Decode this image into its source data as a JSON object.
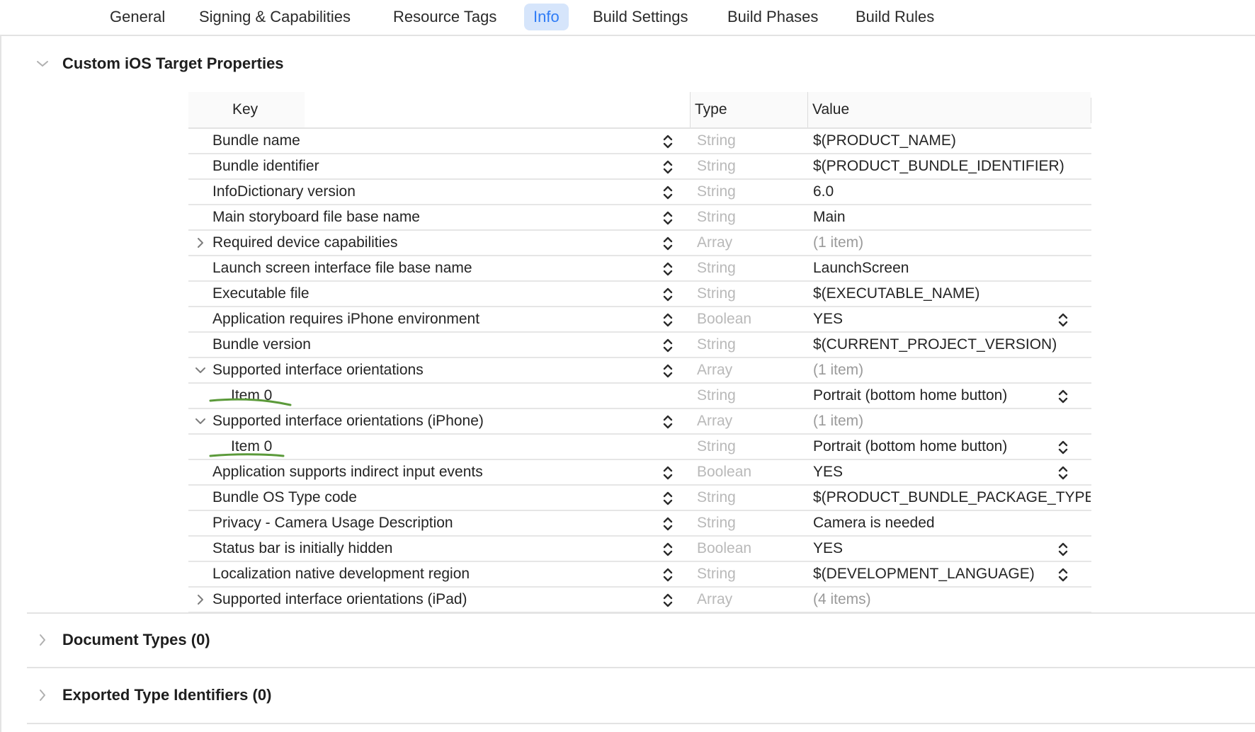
{
  "tabs": [
    {
      "label": "General",
      "active": false
    },
    {
      "label": "Signing & Capabilities",
      "active": false
    },
    {
      "label": "Resource Tags",
      "active": false
    },
    {
      "label": "Info",
      "active": true
    },
    {
      "label": "Build Settings",
      "active": false
    },
    {
      "label": "Build Phases",
      "active": false
    },
    {
      "label": "Build Rules",
      "active": false
    }
  ],
  "sections": {
    "custom": {
      "title": "Custom iOS Target Properties",
      "expanded": true
    },
    "document_types": {
      "title": "Document Types (0)",
      "expanded": false
    },
    "exported_types": {
      "title": "Exported Type Identifiers (0)",
      "expanded": false
    }
  },
  "table": {
    "headers": {
      "key": "Key",
      "type": "Type",
      "value": "Value"
    },
    "rows": [
      {
        "key": "Bundle name",
        "type": "String",
        "value": "$(PRODUCT_NAME)"
      },
      {
        "key": "Bundle identifier",
        "type": "String",
        "value": "$(PRODUCT_BUNDLE_IDENTIFIER)"
      },
      {
        "key": "InfoDictionary version",
        "type": "String",
        "value": "6.0"
      },
      {
        "key": "Main storyboard file base name",
        "type": "String",
        "value": "Main"
      },
      {
        "key": "Required device capabilities",
        "type": "Array",
        "value": "(1 item)",
        "disclosure": "collapsed"
      },
      {
        "key": "Launch screen interface file base name",
        "type": "String",
        "value": "LaunchScreen"
      },
      {
        "key": "Executable file",
        "type": "String",
        "value": "$(EXECUTABLE_NAME)"
      },
      {
        "key": "Application requires iPhone environment",
        "type": "Boolean",
        "value": "YES",
        "value_stepper": true
      },
      {
        "key": "Bundle version",
        "type": "String",
        "value": "$(CURRENT_PROJECT_VERSION)"
      },
      {
        "key": "Supported interface orientations",
        "type": "Array",
        "value": "(1 item)",
        "disclosure": "expanded"
      },
      {
        "key": "Item 0",
        "type": "String",
        "value": "Portrait (bottom home button)",
        "child": true,
        "value_stepper": true
      },
      {
        "key": "Supported interface orientations (iPhone)",
        "type": "Array",
        "value": "(1 item)",
        "disclosure": "expanded"
      },
      {
        "key": "Item 0",
        "type": "String",
        "value": "Portrait (bottom home button)",
        "child": true,
        "value_stepper": true
      },
      {
        "key": "Application supports indirect input events",
        "type": "Boolean",
        "value": "YES",
        "value_stepper": true
      },
      {
        "key": "Bundle OS Type code",
        "type": "String",
        "value": "$(PRODUCT_BUNDLE_PACKAGE_TYPE)"
      },
      {
        "key": "Privacy - Camera Usage Description",
        "type": "String",
        "value": "Camera is needed"
      },
      {
        "key": "Status bar is initially hidden",
        "type": "Boolean",
        "value": "YES",
        "value_stepper": true
      },
      {
        "key": "Localization native development region",
        "type": "String",
        "value": "$(DEVELOPMENT_LANGUAGE)",
        "value_stepper": true
      },
      {
        "key": "Supported interface orientations (iPad)",
        "type": "Array",
        "value": "(4 items)",
        "disclosure": "collapsed"
      }
    ]
  },
  "colors": {
    "accent": "#2f7cf6",
    "active_tab_bg": "#d6e5fb",
    "annotation": "#5b9a3a"
  }
}
